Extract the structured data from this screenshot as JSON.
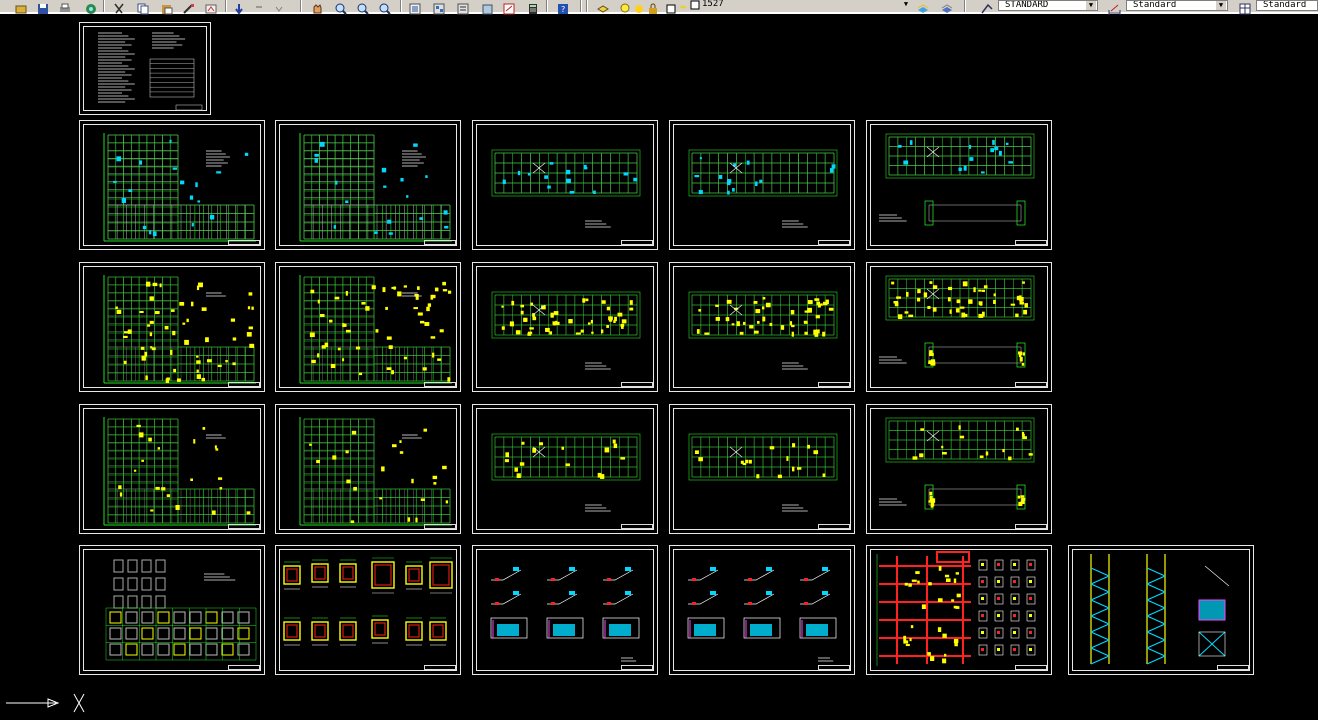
{
  "toolbar": {
    "layer_count": "1527",
    "text_style": "STANDARD",
    "dim_style": "Standard",
    "table_style": "Standard",
    "icons": [
      "open-icon",
      "save-icon",
      "print-icon",
      "plot-icon",
      "cut-icon",
      "copy-icon",
      "paste-icon",
      "match-properties-icon",
      "block-icon",
      "undo-icon",
      "redo-icon",
      "pan-icon",
      "zoom-realtime-icon",
      "zoom-window-icon",
      "zoom-previous-icon",
      "properties-icon",
      "design-center-icon",
      "tool-palettes-icon",
      "sheet-set-icon",
      "markup-icon",
      "calculator-icon",
      "help-icon"
    ]
  },
  "canvas": {
    "background": "#000000",
    "sheets": [
      {
        "row": 0,
        "type": "cover"
      },
      {
        "row": 1,
        "type": "plan-L",
        "tone": "grid"
      },
      {
        "row": 1,
        "type": "plan-L",
        "tone": "grid"
      },
      {
        "row": 1,
        "type": "plan-rect",
        "tone": "grid"
      },
      {
        "row": 1,
        "type": "plan-rect",
        "tone": "grid"
      },
      {
        "row": 1,
        "type": "plan-rect-detail",
        "tone": "grid"
      },
      {
        "row": 2,
        "type": "plan-L",
        "tone": "yellow"
      },
      {
        "row": 2,
        "type": "plan-L",
        "tone": "yellow"
      },
      {
        "row": 2,
        "type": "plan-rect",
        "tone": "yellow"
      },
      {
        "row": 2,
        "type": "plan-rect",
        "tone": "yellow"
      },
      {
        "row": 2,
        "type": "plan-rect-detail",
        "tone": "yellow"
      },
      {
        "row": 3,
        "type": "plan-L",
        "tone": "sparse"
      },
      {
        "row": 3,
        "type": "plan-L",
        "tone": "sparse"
      },
      {
        "row": 3,
        "type": "plan-rect",
        "tone": "sparse"
      },
      {
        "row": 3,
        "type": "plan-rect",
        "tone": "sparse"
      },
      {
        "row": 3,
        "type": "plan-rect-detail",
        "tone": "sparse"
      },
      {
        "row": 4,
        "type": "foundation"
      },
      {
        "row": 4,
        "type": "column-details"
      },
      {
        "row": 4,
        "type": "stair-details"
      },
      {
        "row": 4,
        "type": "stair-details"
      },
      {
        "row": 4,
        "type": "section"
      },
      {
        "row": 4,
        "type": "stair-section"
      }
    ]
  },
  "colors": {
    "grid": "#22dd22",
    "white": "#e8e8e8",
    "yellow": "#ffff00",
    "cyan": "#00d8ff",
    "red": "#ff2020",
    "magenta": "#ff40ff"
  },
  "ucs": {
    "x_label": "X",
    "icon": "ucs-icon"
  }
}
